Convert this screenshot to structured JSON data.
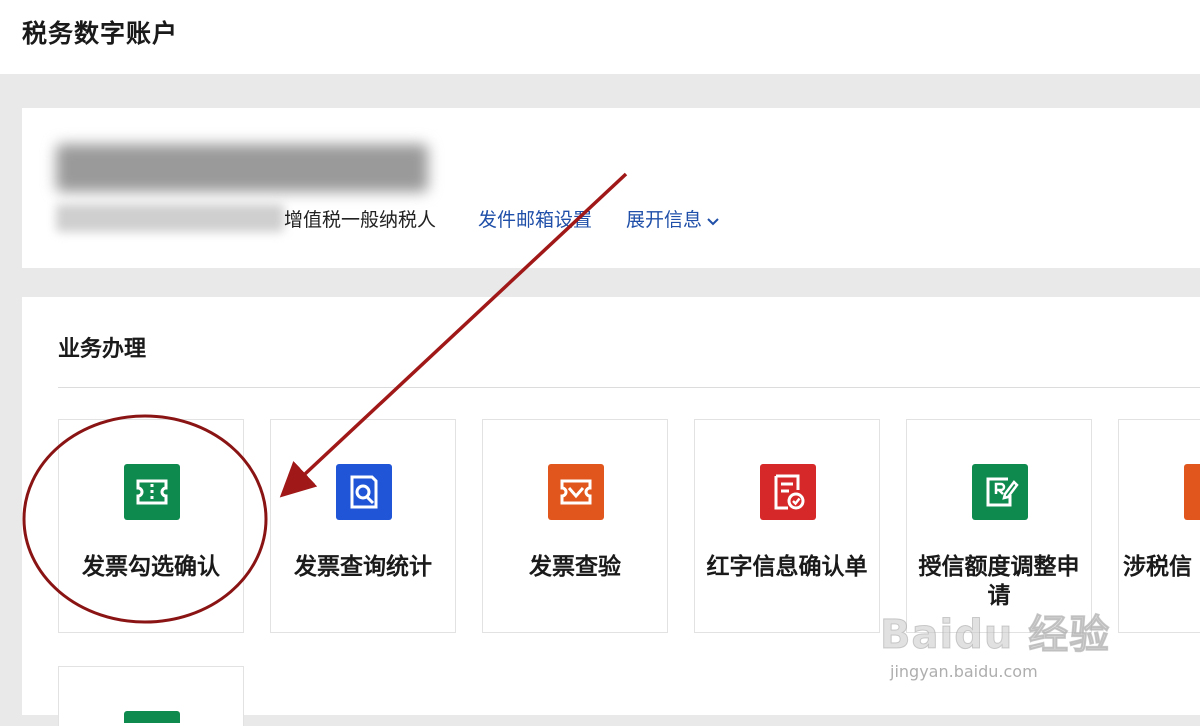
{
  "header": {
    "title": "税务数字账户"
  },
  "account": {
    "taxpayer_type": "增值税一般纳税人",
    "mail_settings_link": "发件邮箱设置",
    "expand_link": "展开信息"
  },
  "business": {
    "section_title": "业务办理",
    "tiles": [
      {
        "label": "发票勾选确认",
        "icon": "ticket-icon",
        "color": "#0f8a4f"
      },
      {
        "label": "发票查询统计",
        "icon": "search-document-icon",
        "color": "#1f55d6"
      },
      {
        "label": "发票查验",
        "icon": "ticket-check-icon",
        "color": "#e0561c"
      },
      {
        "label": "红字信息确认单",
        "icon": "document-check-icon",
        "color": "#d62828"
      },
      {
        "label": "授信额度调整申请",
        "icon": "edit-document-icon",
        "color": "#0f8a4f"
      },
      {
        "label": "涉税信",
        "icon": "orange-service-icon",
        "color": "#e0561c"
      },
      {
        "label": "",
        "icon": "green-partial-icon",
        "color": "#0f8a4f"
      }
    ]
  },
  "annotation": {
    "arrow_color": "#a01818",
    "circle_color": "#8a1414"
  },
  "watermark": {
    "logo": "Baidu 经验",
    "url": "jingyan.baidu.com"
  }
}
